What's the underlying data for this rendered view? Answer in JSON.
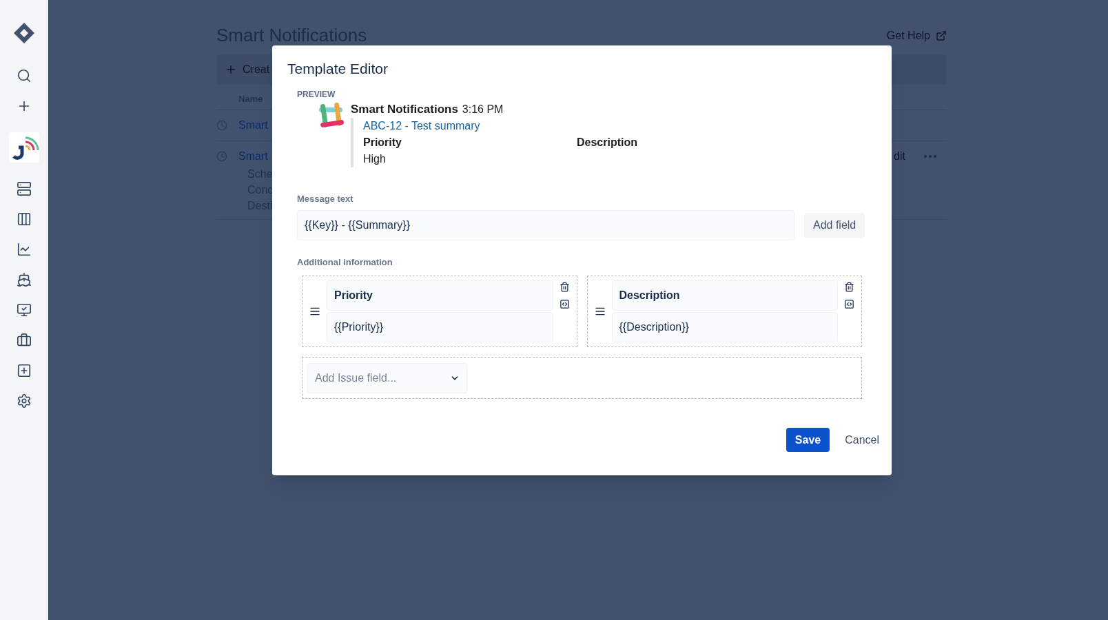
{
  "page": {
    "title": "Smart Notifications",
    "help_link": "Get Help",
    "create_button": "Creat",
    "name_column": "Name",
    "rows": [
      {
        "name": "Smart",
        "edit": "",
        "details": []
      },
      {
        "name": "Smart",
        "edit": "dit",
        "details": [
          "Sche",
          "Conc",
          "Desti"
        ]
      }
    ]
  },
  "dialog": {
    "title": "Template Editor",
    "preview": {
      "heading": "PREVIEW",
      "app_name": "Smart Notifications",
      "time": "3:16 PM",
      "link": "ABC-12 - Test summary",
      "fields": [
        {
          "label": "Priority",
          "value": "High"
        },
        {
          "label": "Description"
        }
      ]
    },
    "message_text": {
      "label": "Message text",
      "value": "{{Key}} - {{Summary}}",
      "add_button": "Add field"
    },
    "additional_information": {
      "label": "Additional information",
      "fields": [
        {
          "label": "Priority",
          "value": "{{Priority}}"
        },
        {
          "label": "Description",
          "value": "{{Description}}"
        }
      ],
      "add_select": {
        "placeholder": "Add Issue field..."
      }
    },
    "buttons": {
      "save": "Save",
      "cancel": "Cancel"
    }
  }
}
